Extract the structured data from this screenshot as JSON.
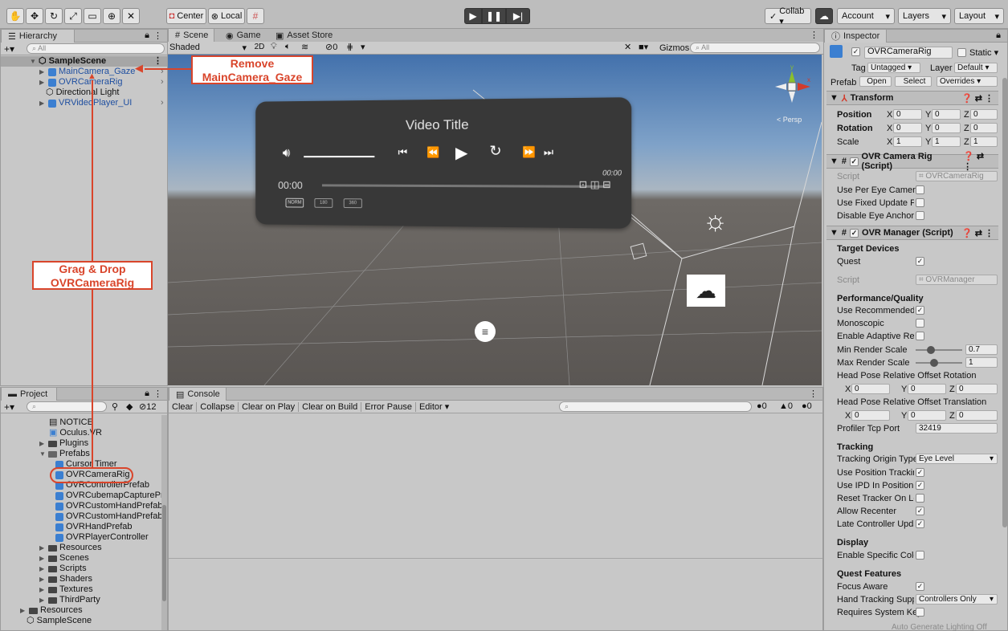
{
  "toolbar": {
    "center_label": "Center",
    "local_label": "Local",
    "collab_label": "Collab ▾",
    "account_label": "Account",
    "layers_label": "Layers",
    "layout_label": "Layout"
  },
  "hierarchy": {
    "tab_label": "Hierarchy",
    "search_placeholder": "All",
    "scene_name": "SampleScene",
    "items": [
      "MainCamera_Gaze",
      "OVRCameraRig",
      "Directional Light",
      "VRVideoPlayer_UI"
    ]
  },
  "scene_tabs": {
    "scene": "Scene",
    "game": "Game",
    "asset_store": "Asset Store"
  },
  "scene_toolbar": {
    "shaded": "Shaded",
    "twod": "2D",
    "hidden_count": "0",
    "gizmos": "Gizmos",
    "search_placeholder": "All",
    "persp": "< Persp"
  },
  "video_player": {
    "title": "Video Title",
    "current_time": "00:00",
    "end_time": "00:00",
    "quality": [
      "NORM",
      "180",
      "360"
    ]
  },
  "project": {
    "tab_label": "Project",
    "hidden_count": "12",
    "items": [
      "NOTICE",
      "Oculus.VR",
      "Plugins",
      "Prefabs",
      "Cursor Timer",
      "OVRCameraRig",
      "OVRControllerPrefab",
      "OVRCubemapCapturePro",
      "OVRCustomHandPrefab_",
      "OVRCustomHandPrefab_",
      "OVRHandPrefab",
      "OVRPlayerController",
      "Resources",
      "Scenes",
      "Scripts",
      "Shaders",
      "Textures",
      "ThirdParty",
      "Resources",
      "SampleScene"
    ]
  },
  "console": {
    "tab_label": "Console",
    "buttons": [
      "Clear",
      "Collapse",
      "Clear on Play",
      "Clear on Build",
      "Error Pause",
      "Editor ▾"
    ],
    "counts": [
      "0",
      "0",
      "0"
    ]
  },
  "inspector": {
    "tab_label": "Inspector",
    "object_name": "OVRCameraRig",
    "static_label": "Static",
    "tag_label": "Tag",
    "tag_value": "Untagged",
    "layer_label": "Layer",
    "layer_value": "Default",
    "prefab_label": "Prefab",
    "open_label": "Open",
    "select_label": "Select",
    "overrides_label": "Overrides",
    "transform": {
      "title": "Transform",
      "rows": [
        {
          "label": "Position",
          "x": "0",
          "y": "0",
          "z": "0"
        },
        {
          "label": "Rotation",
          "x": "0",
          "y": "0",
          "z": "0"
        },
        {
          "label": "Scale",
          "x": "1",
          "y": "1",
          "z": "1"
        }
      ]
    },
    "camera_rig": {
      "title": "OVR Camera Rig (Script)",
      "script_label": "Script",
      "script_value": "OVRCameraRig",
      "props": [
        "Use Per Eye Cameras",
        "Use Fixed Update For",
        "Disable Eye Anchor C"
      ]
    },
    "manager": {
      "title": "OVR Manager (Script)",
      "target_devices": "Target Devices",
      "quest": "Quest",
      "script_label": "Script",
      "script_value": "OVRManager",
      "perf_header": "Performance/Quality",
      "perf_props": [
        "Use Recommended M",
        "Monoscopic",
        "Enable Adaptive Resc",
        "Min Render Scale",
        "Max Render Scale"
      ],
      "min_scale": "0.7",
      "max_scale": "1",
      "offset_rot_label": "Head Pose Relative Offset Rotation",
      "offset_rot": {
        "x": "0",
        "y": "0",
        "z": "0"
      },
      "offset_trans_label": "Head Pose Relative Offset Translation",
      "offset_trans": {
        "x": "0",
        "y": "0",
        "z": "0"
      },
      "profiler_label": "Profiler Tcp Port",
      "profiler_value": "32419",
      "tracking_header": "Tracking",
      "tracking_origin_label": "Tracking Origin Type",
      "tracking_origin_value": "Eye Level",
      "tracking_props": [
        "Use Position Tracking",
        "Use IPD In Position Tr",
        "Reset Tracker On Loa",
        "Allow Recenter",
        "Late Controller Updat"
      ],
      "display_header": "Display",
      "display_prop": "Enable Specific Color",
      "quest_header": "Quest Features",
      "focus_aware": "Focus Aware",
      "hand_tracking_label": "Hand Tracking Suppo",
      "hand_tracking_value": "Controllers Only",
      "requires_key": "Requires System Key"
    }
  },
  "status_bar": "Auto Generate Lighting Off",
  "annotations": {
    "remove_line1": "Remove",
    "remove_line2": "MainCamera_Gaze",
    "drag_line1": "Grag & Drop",
    "drag_line2": "OVRCameraRig"
  },
  "colors": {
    "annotation": "#d9452b",
    "prefab_blue": "#3b7fd1"
  }
}
